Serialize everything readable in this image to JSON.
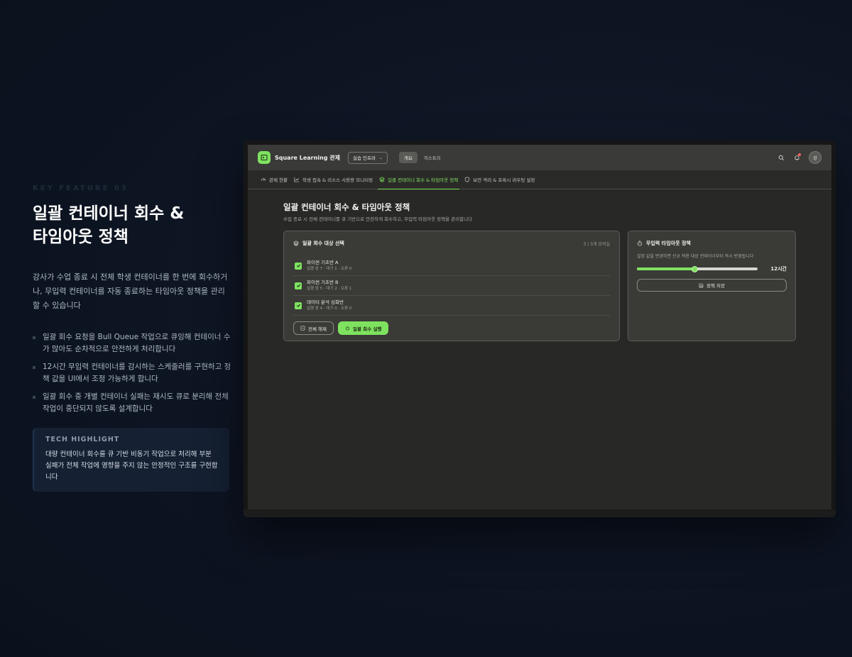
{
  "feature": {
    "kicker": "KEY FEATURE 03",
    "headline_line1": "일괄 컨테이너 회수 &",
    "headline_line2": "타임아웃 정책",
    "description": "강사가 수업 종료 시 전체 학생 컨테이너를 한 번에 회수하거나, 무입력 컨테이너를 자동 종료하는 타임아웃 정책을 관리할 수 있습니다",
    "bullets": [
      "일괄 회수 요청을 Bull Queue 작업으로 큐잉해 컨테이너 수가 많아도 순차적으로 안전하게 처리합니다",
      "12시간 무입력 컨테이너를 감시하는 스케줄러를 구현하고 정책 값을 UI에서 조정 가능하게 합니다",
      "일괄 회수 중 개별 컨테이너 실패는 재시도 큐로 분리해 전체 작업이 중단되지 않도록 설계합니다"
    ],
    "tech_title": "TECH HIGHLIGHT",
    "tech_body": "대량 컨테이너 회수를 큐 기반 비동기 작업으로 처리해 부분 실패가 전체 작업에 영향을 주지 않는 안정적인 구조를 구현합니다"
  },
  "app": {
    "title": "Square Learning 관제",
    "env_select": "실습 인프라",
    "nav_tabs": [
      "개요",
      "히스토리"
    ],
    "active_nav": "개요",
    "avatar_text": "강",
    "subnav": [
      {
        "label": "관제 현황",
        "icon": "gauge-icon"
      },
      {
        "label": "학생 접속 & 리소스 사용량 모니터링",
        "icon": "line-chart-icon"
      },
      {
        "label": "일괄 컨테이너 회수 & 타임아웃 정책",
        "icon": "layers-icon"
      },
      {
        "label": "보안 격리 & 프록시 라우팅 설정",
        "icon": "shield-icon"
      }
    ],
    "active_subnav": "일괄 컨테이너 회수 & 타임아웃 정책",
    "page_title": "일괄 컨테이너 회수 & 타임아웃 정책",
    "page_subtitle": "수업 종료 시 전체 컨테이너를 큐 기반으로 안전하게 회수하고, 무입력 타임아웃 정책을 관리합니다",
    "bulk_card": {
      "title": "일괄 회수 대상 선택",
      "meta": "3 / 3개 강의실",
      "rows": [
        {
          "name": "파이썬 기초반 A",
          "stat": "실행 중 7 · 대기 1 · 오류 0",
          "checked": true
        },
        {
          "name": "파이썬 기초반 B",
          "stat": "실행 중 5 · 대기 2 · 오류 1",
          "checked": true
        },
        {
          "name": "데이터 분석 심화반",
          "stat": "실행 중 4 · 대기 0 · 오류 0",
          "checked": true
        }
      ],
      "deselect_label": "전체 해제",
      "run_label": "일괄 회수 실행"
    },
    "policy_card": {
      "title": "무입력 타임아웃 정책",
      "description": "설정 값을 변경하면 신규 적용 대상 컨테이너부터 즉시 반영됩니다",
      "slider_fraction": 0.48,
      "value_label": "12시간",
      "save_label": "정책 저장"
    }
  },
  "colors": {
    "accent": "#7ee25f",
    "background": "#0d1422",
    "app_bg": "#282826"
  }
}
